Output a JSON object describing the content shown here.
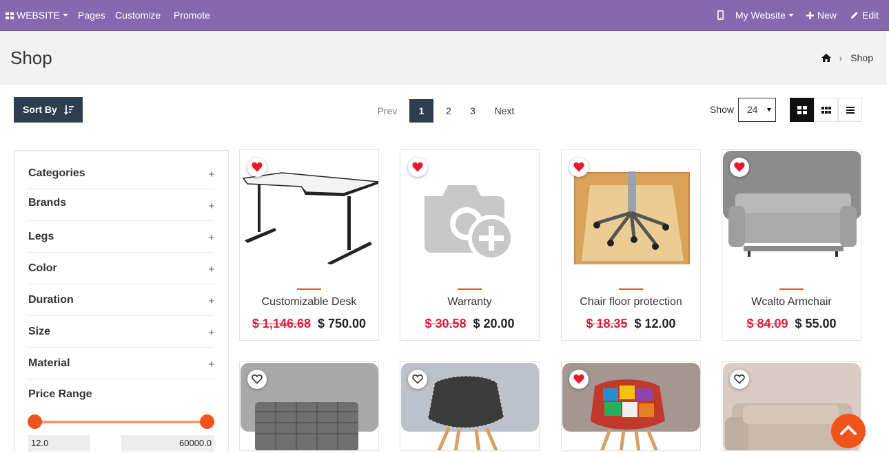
{
  "topbar": {
    "website_menu": "WEBSITE",
    "pages": "Pages",
    "customize": "Customize",
    "promote": "Promote",
    "my_website": "My Website",
    "new": "New",
    "edit": "Edit"
  },
  "header": {
    "title": "Shop",
    "breadcrumb_current": "Shop"
  },
  "toolbar": {
    "sort_label": "Sort By",
    "pager": {
      "prev": "Prev",
      "pages": [
        "1",
        "2",
        "3"
      ],
      "next": "Next",
      "current": "1"
    },
    "show_label": "Show",
    "show_value": "24"
  },
  "sidebar": {
    "filters": [
      "Categories",
      "Brands",
      "Legs",
      "Color",
      "Duration",
      "Size",
      "Material"
    ],
    "expand_symbol": "+",
    "price_range": {
      "title": "Price Range",
      "min": "12.0",
      "max": "60000.0"
    }
  },
  "products": [
    {
      "name": "Customizable Desk",
      "old_price": "$ 1,146.68",
      "price": "$ 750.00",
      "wishlisted": true
    },
    {
      "name": "Warranty",
      "old_price": "$ 30.58",
      "price": "$ 20.00",
      "wishlisted": true
    },
    {
      "name": "Chair floor protection",
      "old_price": "$ 18.35",
      "price": "$ 12.00",
      "wishlisted": true
    },
    {
      "name": "Wcalto Armchair",
      "old_price": "$ 84.09",
      "price": "$ 55.00",
      "wishlisted": true
    }
  ],
  "products_row2": [
    {
      "wishlisted": false
    },
    {
      "wishlisted": false
    },
    {
      "wishlisted": true
    },
    {
      "wishlisted": false
    }
  ],
  "colors": {
    "topbar": "#8668ae",
    "dark_button": "#2c3e50",
    "accent": "#f0541a",
    "sale_price": "#d9203c",
    "heart": "#e8192c"
  }
}
